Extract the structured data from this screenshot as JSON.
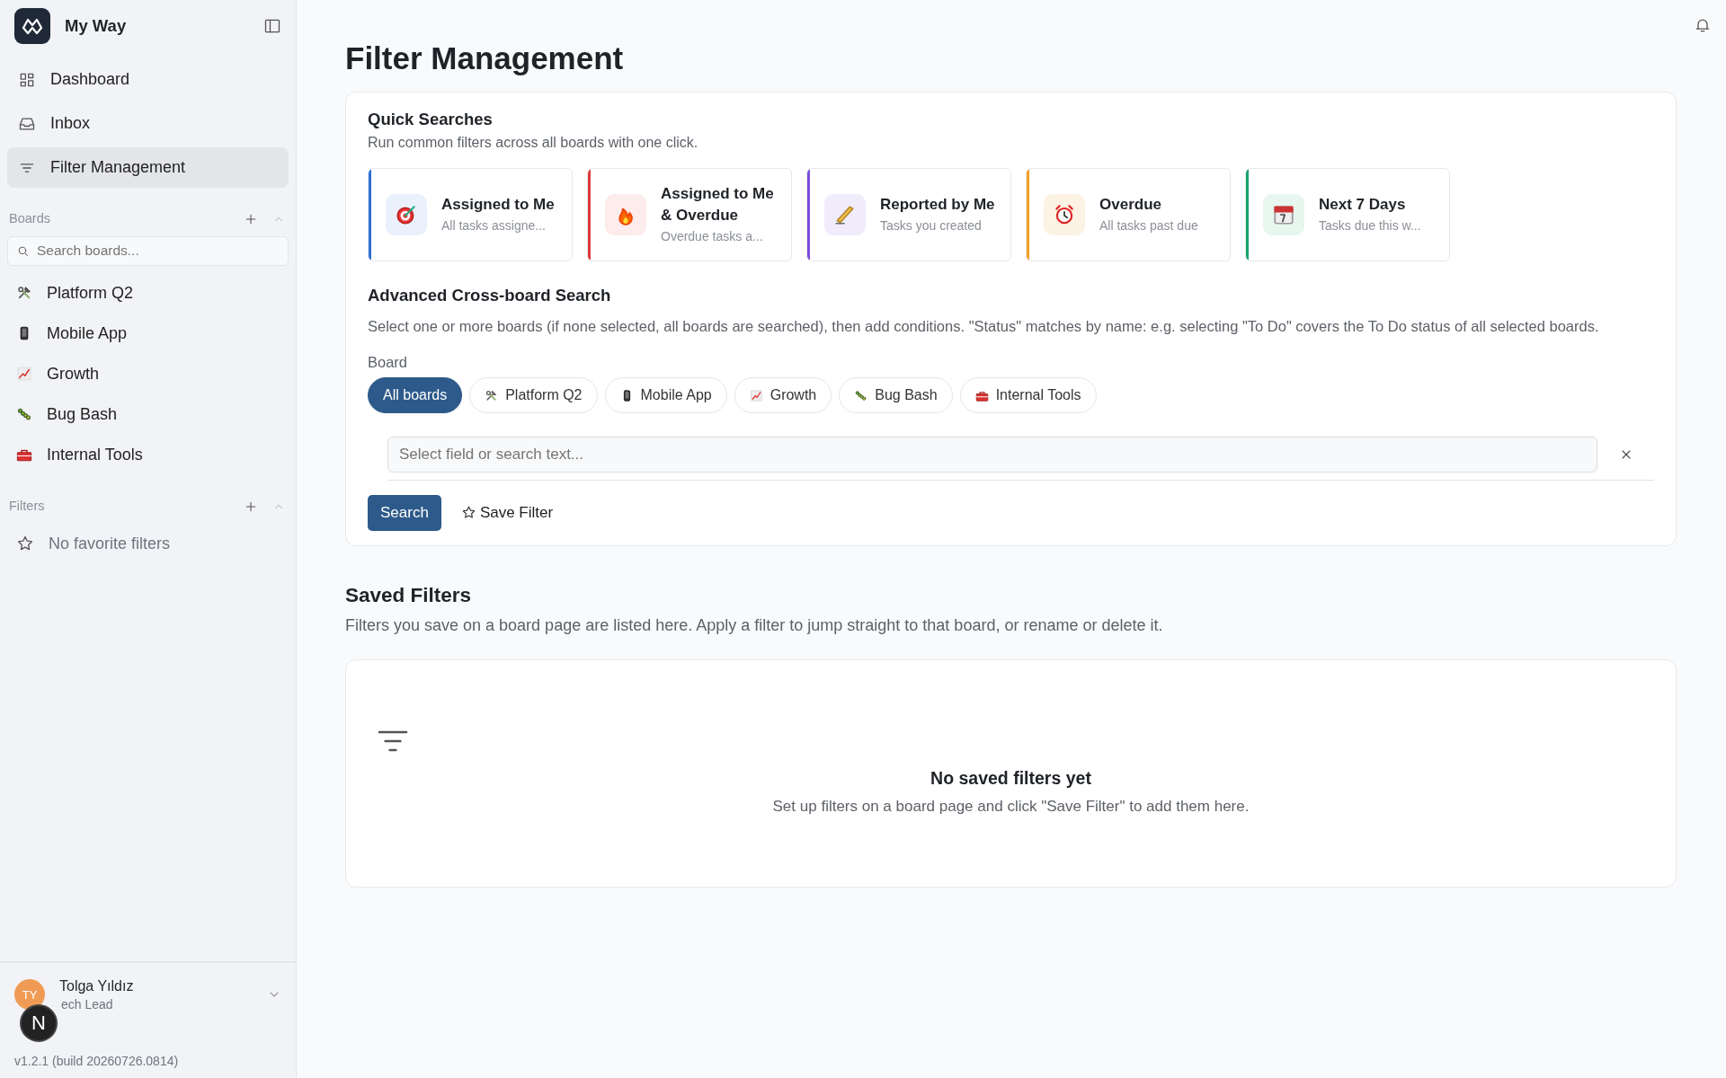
{
  "app": {
    "name": "My Way"
  },
  "nav": [
    {
      "label": "Dashboard",
      "selected": false
    },
    {
      "label": "Inbox",
      "selected": false
    },
    {
      "label": "Filter Management",
      "selected": true
    }
  ],
  "boards_section": {
    "title": "Boards",
    "search_placeholder": "Search boards..."
  },
  "boards": [
    {
      "label": "Platform Q2"
    },
    {
      "label": "Mobile App"
    },
    {
      "label": "Growth"
    },
    {
      "label": "Bug Bash"
    },
    {
      "label": "Internal Tools"
    }
  ],
  "filters_section": {
    "title": "Filters",
    "empty": "No favorite filters"
  },
  "user": {
    "initials": "TY",
    "name": "Tolga Yıldız",
    "role": "ech Lead",
    "version": "v1.2.1 (build 20260726.0814)"
  },
  "dev_badge": "N",
  "page_title": "Filter Management",
  "quick_searches": {
    "title": "Quick Searches",
    "subtitle": "Run common filters across all boards with one click.",
    "items": [
      {
        "title": "Assigned to Me",
        "desc": "All tasks assigne...",
        "color": "#2f6fd6"
      },
      {
        "title": "Assigned to Me & Overdue",
        "desc": "Overdue tasks a...",
        "color": "#dc3b3b"
      },
      {
        "title": "Reported by Me",
        "desc": "Tasks you created",
        "color": "#7c4ddc"
      },
      {
        "title": "Overdue",
        "desc": "All tasks past due",
        "color": "#f0a020"
      },
      {
        "title": "Next 7 Days",
        "desc": "Tasks due this w...",
        "color": "#16a36a"
      }
    ]
  },
  "advanced": {
    "title": "Advanced Cross-board Search",
    "description": "Select one or more boards (if none selected, all boards are searched), then add conditions. \"Status\" matches by name: e.g. selecting \"To Do\" covers the To Do status of all selected boards.",
    "board_label": "Board",
    "chips": [
      {
        "label": "All boards",
        "selected": true
      },
      {
        "label": "Platform Q2",
        "selected": false
      },
      {
        "label": "Mobile App",
        "selected": false
      },
      {
        "label": "Growth",
        "selected": false
      },
      {
        "label": "Bug Bash",
        "selected": false
      },
      {
        "label": "Internal Tools",
        "selected": false
      }
    ],
    "field_placeholder": "Select field or search text...",
    "search_button": "Search",
    "save_button": "Save Filter"
  },
  "saved_filters": {
    "title": "Saved Filters",
    "description": "Filters you save on a board page are listed here. Apply a filter to jump straight to that board, or rename or delete it.",
    "empty_title": "No saved filters yet",
    "empty_text": "Set up filters on a board page and click \"Save Filter\" to add them here."
  }
}
